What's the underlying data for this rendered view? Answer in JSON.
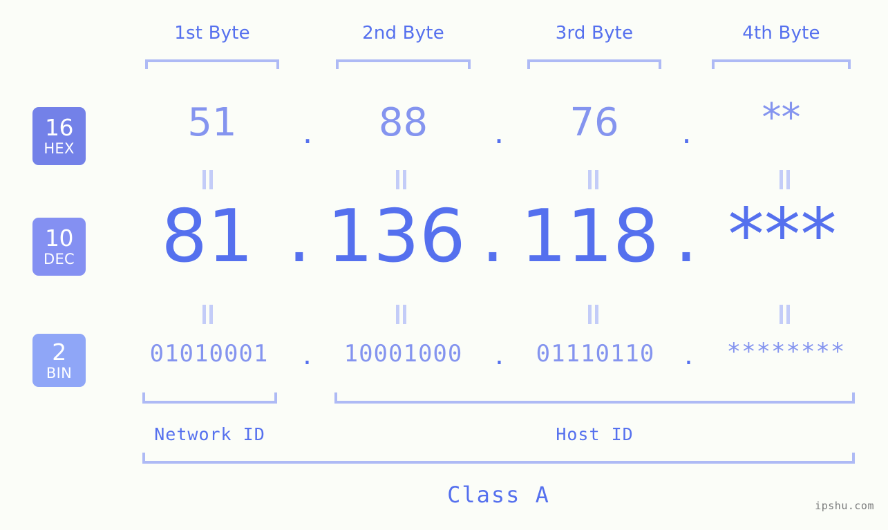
{
  "page": {
    "background": "#fbfdf8",
    "accent": "#5570ee",
    "accent_light": "#8494ef",
    "bracket_color": "#aebaf5",
    "watermark": "ipshu.com"
  },
  "columns": [
    {
      "header": "1st Byte"
    },
    {
      "header": "2nd Byte"
    },
    {
      "header": "3rd Byte"
    },
    {
      "header": "4th Byte"
    }
  ],
  "rows": [
    {
      "badge_number": "16",
      "badge_abbr": "HEX",
      "badge_color": "#7381e8",
      "values": [
        "51",
        "88",
        "76",
        "**"
      ],
      "separator": "."
    },
    {
      "badge_number": "10",
      "badge_abbr": "DEC",
      "badge_color": "#8490f2",
      "values": [
        "81",
        "136",
        "118",
        "***"
      ],
      "separator": "."
    },
    {
      "badge_number": "2",
      "badge_abbr": "BIN",
      "badge_color": "#8fa6f7",
      "values": [
        "01010001",
        "10001000",
        "01110110",
        "********"
      ],
      "separator": "."
    }
  ],
  "equals_symbol": "||",
  "sections": {
    "network_id": "Network ID",
    "host_id": "Host ID",
    "class": "Class A"
  },
  "chart_data": {
    "type": "table",
    "title": "IP address byte breakdown",
    "categories": [
      "1st Byte",
      "2nd Byte",
      "3rd Byte",
      "4th Byte"
    ],
    "series": [
      {
        "name": "HEX",
        "values": [
          "51",
          "88",
          "76",
          "**"
        ]
      },
      {
        "name": "DEC",
        "values": [
          "81",
          "136",
          "118",
          "***"
        ]
      },
      {
        "name": "BIN",
        "values": [
          "01010001",
          "10001000",
          "01110110",
          "********"
        ]
      }
    ],
    "annotations": [
      "Network ID",
      "Host ID",
      "Class A"
    ]
  }
}
